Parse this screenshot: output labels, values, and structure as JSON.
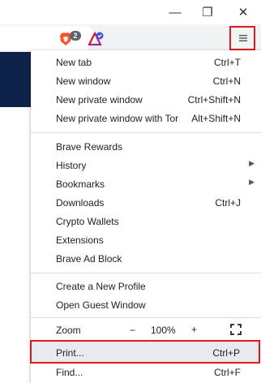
{
  "window": {
    "minimize_glyph": "—",
    "restore_glyph": "❐",
    "close_glyph": "✕"
  },
  "toolbar": {
    "shields_count": "2",
    "menu_icon": "hamburger-icon",
    "accent_highlight": "#e0191d"
  },
  "menu": {
    "new_tab": {
      "label": "New tab",
      "shortcut": "Ctrl+T"
    },
    "new_window": {
      "label": "New window",
      "shortcut": "Ctrl+N"
    },
    "new_private_window": {
      "label": "New private window",
      "shortcut": "Ctrl+Shift+N"
    },
    "new_private_tor": {
      "label": "New private window with Tor",
      "shortcut": "Alt+Shift+N"
    },
    "brave_rewards": {
      "label": "Brave Rewards"
    },
    "history": {
      "label": "History"
    },
    "bookmarks": {
      "label": "Bookmarks"
    },
    "downloads": {
      "label": "Downloads",
      "shortcut": "Ctrl+J"
    },
    "crypto_wallets": {
      "label": "Crypto Wallets"
    },
    "extensions": {
      "label": "Extensions"
    },
    "brave_ad_block": {
      "label": "Brave Ad Block"
    },
    "create_profile": {
      "label": "Create a New Profile"
    },
    "guest_window": {
      "label": "Open Guest Window"
    },
    "zoom": {
      "label": "Zoom",
      "minus": "−",
      "value": "100%",
      "plus": "+"
    },
    "print": {
      "label": "Print...",
      "shortcut": "Ctrl+P"
    },
    "find": {
      "label": "Find...",
      "shortcut": "Ctrl+F"
    }
  }
}
